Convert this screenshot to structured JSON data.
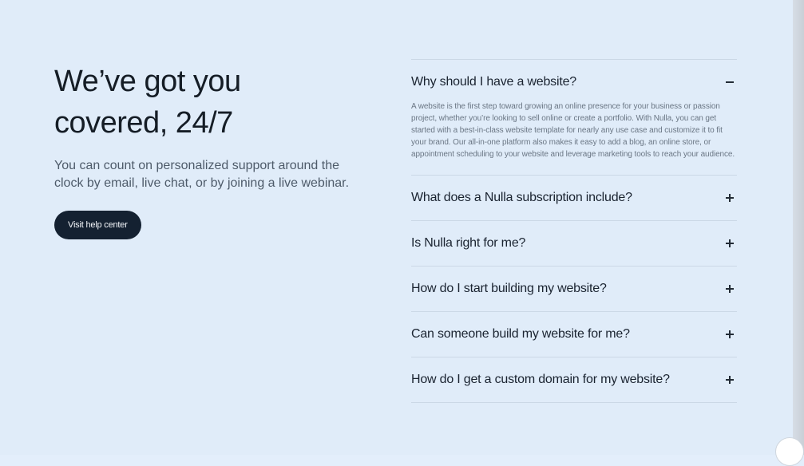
{
  "hero": {
    "headline_line1": "We’ve got you",
    "headline_line2": "covered, 24/7",
    "subtext": "You can count on personalized support around the clock by email, live chat, or by joining a live webinar.",
    "button_label": "Visit help center"
  },
  "faq": {
    "items": [
      {
        "question": "Why should I have a website?",
        "expanded": true,
        "answer": "A website is the first step toward growing an online presence for your business or passion project, whether you’re looking to sell online or create a portfolio. With Nulla, you can get started with a best-in-class website template for nearly any use case and customize it to fit your brand. Our all-in-one platform also makes it easy to add a blog, an online store, or appointment scheduling to your website and leverage marketing tools to reach your audience."
      },
      {
        "question": "What does a Nulla subscription include?",
        "expanded": false
      },
      {
        "question": "Is Nulla right for me?",
        "expanded": false
      },
      {
        "question": "How do I start building my website?",
        "expanded": false
      },
      {
        "question": "Can someone build my website for me?",
        "expanded": false
      },
      {
        "question": "How do I get a custom domain for my website?",
        "expanded": false
      }
    ]
  },
  "colors": {
    "background": "#e0ecf9",
    "button": "#142131",
    "divider": "#cbd8e6"
  },
  "icons": {
    "expanded": "minus-icon",
    "collapsed": "plus-icon"
  }
}
